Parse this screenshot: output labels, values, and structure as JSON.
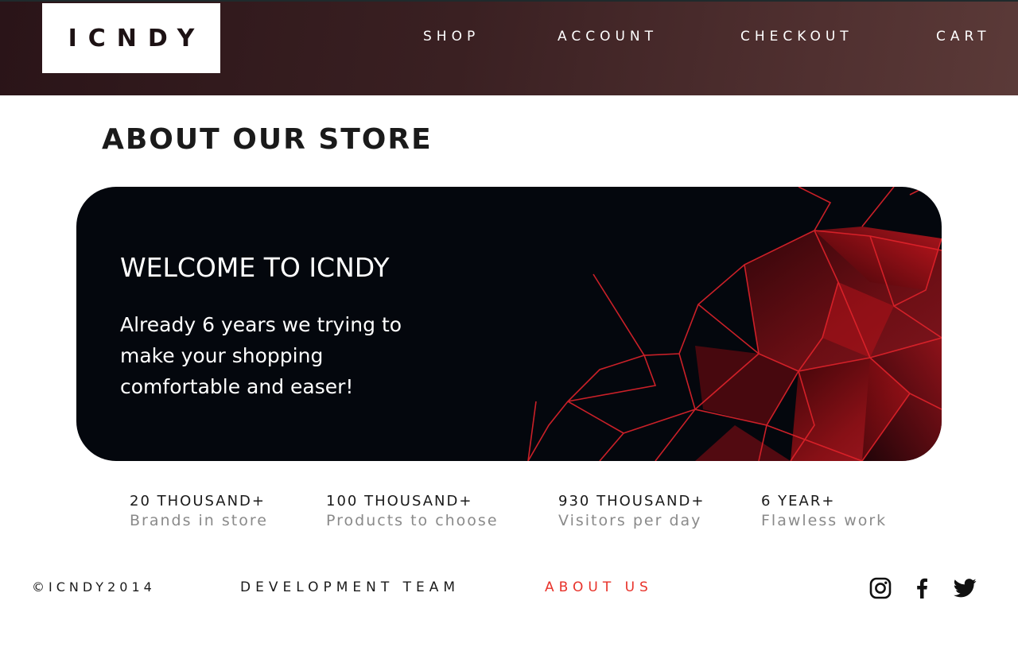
{
  "header": {
    "logo": "ICNDY",
    "nav": [
      "SHOP",
      "ACCOUNT",
      "CHECKOUT",
      "CART"
    ]
  },
  "page": {
    "title": "ABOUT OUR STORE"
  },
  "banner": {
    "title": "WELCOME TO ICNDY",
    "text": "Already 6 years we trying to make your shopping comfortable and easer!"
  },
  "stats": [
    {
      "value": "20 THOUSAND+",
      "label": "Brands in store"
    },
    {
      "value": "100 THOUSAND+",
      "label": "Products to choose"
    },
    {
      "value": "930 THOUSAND+",
      "label": "Visitors per day"
    },
    {
      "value": "6 YEAR+",
      "label": "Flawless work"
    }
  ],
  "footer": {
    "copyright": "©ICNDY2014",
    "links": [
      "DEVELOPMENT TEAM",
      "ABOUT US"
    ],
    "active_link_color": "#e8322a",
    "social_icons": [
      "instagram-icon",
      "facebook-icon",
      "twitter-icon"
    ]
  }
}
